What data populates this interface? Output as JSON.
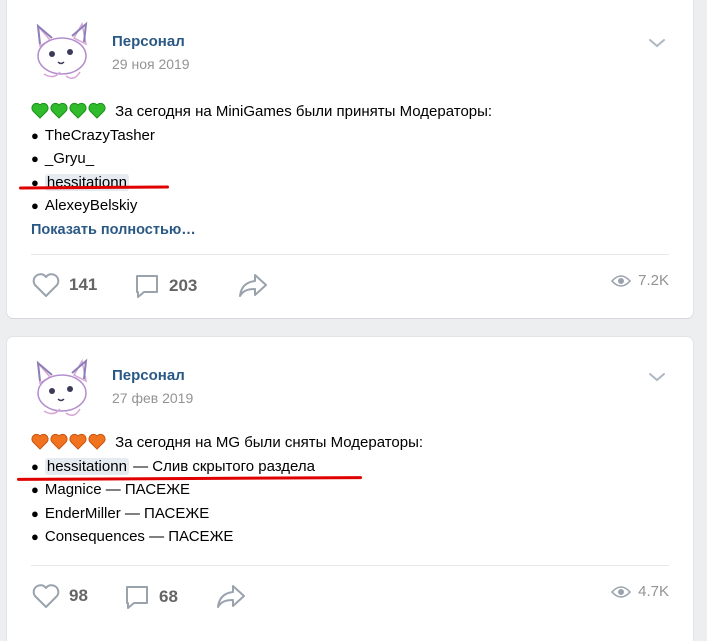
{
  "posts": [
    {
      "author": "Персонал",
      "date": "29 ноя 2019",
      "heart_color": "#2fbb2c",
      "heart_count": 4,
      "headline": "За сегодня на MiniGames были приняты Модераторы:",
      "items": [
        {
          "name": "TheCrazyTasher",
          "note": ""
        },
        {
          "name": "_Gryu_",
          "note": ""
        },
        {
          "name": "hessitationn",
          "note": "",
          "highlighted": true
        },
        {
          "name": "AlexeyBelskiy",
          "note": ""
        }
      ],
      "show_more": "Показать полностью…",
      "likes": "141",
      "comments": "203",
      "views": "7.2K"
    },
    {
      "author": "Персонал",
      "date": "27 фев 2019",
      "heart_color": "#f2731f",
      "heart_count": 4,
      "headline": "За сегодня на MG были сняты Модераторы:",
      "items": [
        {
          "name": "hessitationn",
          "note": " — Слив скрытого раздела",
          "highlighted": true
        },
        {
          "name": "Magnice",
          "note": " — ПАСЕЖЕ"
        },
        {
          "name": "EnderMiller",
          "note": " — ПАСЕЖЕ"
        },
        {
          "name": "Consequences",
          "note": " — ПАСЕЖЕ"
        }
      ],
      "likes": "98",
      "comments": "68",
      "views": "4.7K"
    }
  ],
  "colors": {
    "link": "#2a5885",
    "muted": "#939393",
    "underline": "#e00000",
    "background": "#edeef0"
  },
  "icons": {
    "like": "heart-outline-icon",
    "comment": "speech-bubble-icon",
    "share": "share-arrow-icon",
    "views": "eye-icon",
    "menu": "chevron-down-icon"
  }
}
